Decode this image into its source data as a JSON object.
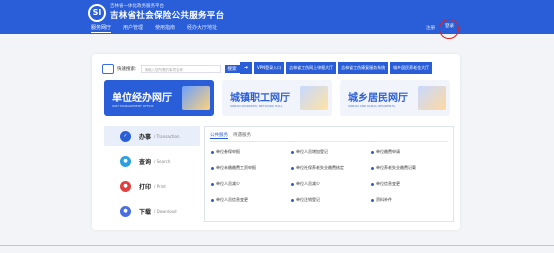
{
  "header": {
    "logo_text": "SI",
    "brand_small": "吉林省一体化政务服务平台",
    "brand_big": "吉林省社会保险公共服务平台",
    "nav": [
      "服务网厅",
      "用户管理",
      "使用指南",
      "经办大厅地址"
    ],
    "register": "注册",
    "login": "登录"
  },
  "quick": {
    "label": "快速搜索:",
    "placeholder": "请输入您所需的事项名称",
    "search_btn": "搜索",
    "links": [
      "VPN登录入口",
      "吉林省工伤网上申报大厅",
      "吉林省工伤康复服务系统",
      "城乡居民养老金大厅"
    ]
  },
  "halls": [
    {
      "title": "单位经办网厅",
      "sub": "UNIT MANAGEMENT OFFICE"
    },
    {
      "title": "城镇职工网厅",
      "sub": "URBAN WORKERS' NETWORK HALL"
    },
    {
      "title": "城乡居民网厅",
      "sub": "URBAN AND RURAL RESIDENTS"
    }
  ],
  "menu": [
    {
      "label": "办事",
      "en": "/ Transaction",
      "color": "#2a5ed8"
    },
    {
      "label": "查询",
      "en": "/ Search",
      "color": "#2aa0e0"
    },
    {
      "label": "打印",
      "en": "/ Print",
      "color": "#e04040"
    },
    {
      "label": "下载",
      "en": "/ Download",
      "color": "#4a6ee0"
    }
  ],
  "tabs": [
    "公共服务",
    "待遇服务"
  ],
  "services": [
    [
      "单位参保申报",
      "单位人员增加登记",
      "单位缴费申请"
    ],
    [
      "单位未缴缴费工资申报",
      "单位社保养老失业缴费核定",
      "单位养老失业缴费记载"
    ],
    [
      "单位人员减少",
      "单位人员减少",
      "单位信息变更"
    ],
    [
      "单位人员信息变更",
      "单位注销登记",
      "资料补件"
    ]
  ]
}
